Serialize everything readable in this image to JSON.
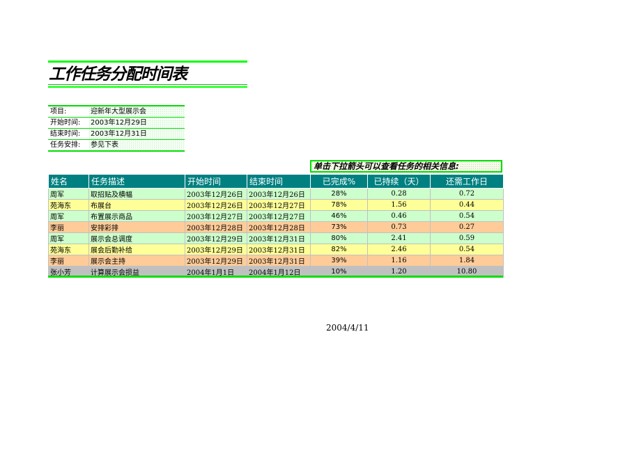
{
  "title": "工作任务分配时间表",
  "info": [
    {
      "label": "项目:",
      "value": "迎新年大型展示会"
    },
    {
      "label": "开始时间:",
      "value": "2003年12月29日"
    },
    {
      "label": "结束时间:",
      "value": "2003年12月31日"
    },
    {
      "label": "任务安排:",
      "value": "参见下表"
    }
  ],
  "hint": "单击下拉箭头可以查看任务的相关信息:",
  "table": {
    "headers": [
      "姓名",
      "任务描述",
      "开始时间",
      "结束时间",
      "已完成%",
      "已持续（天）",
      "还需工作日"
    ],
    "rows": [
      {
        "name": "周军",
        "task": "取招贴及横幅",
        "start": "2003年12月26日",
        "end": "2003年12月26日",
        "pct": "28%",
        "elapsed": "0.28",
        "remaining": "0.72",
        "color": "g"
      },
      {
        "name": "苑海东",
        "task": "布展台",
        "start": "2003年12月26日",
        "end": "2003年12月27日",
        "pct": "78%",
        "elapsed": "1.56",
        "remaining": "0.44",
        "color": "y"
      },
      {
        "name": "周军",
        "task": "布置展示商品",
        "start": "2003年12月27日",
        "end": "2003年12月27日",
        "pct": "46%",
        "elapsed": "0.46",
        "remaining": "0.54",
        "color": "g"
      },
      {
        "name": "李丽",
        "task": "安排彩排",
        "start": "2003年12月28日",
        "end": "2003年12月28日",
        "pct": "73%",
        "elapsed": "0.73",
        "remaining": "0.27",
        "color": "o"
      },
      {
        "name": "周军",
        "task": "展示会总调度",
        "start": "2003年12月29日",
        "end": "2003年12月31日",
        "pct": "80%",
        "elapsed": "2.41",
        "remaining": "0.59",
        "color": "g"
      },
      {
        "name": "苑海东",
        "task": "展会后勤补给",
        "start": "2003年12月29日",
        "end": "2003年12月31日",
        "pct": "82%",
        "elapsed": "2.46",
        "remaining": "0.54",
        "color": "y"
      },
      {
        "name": "李丽",
        "task": "展示会主持",
        "start": "2003年12月29日",
        "end": "2003年12月31日",
        "pct": "39%",
        "elapsed": "1.16",
        "remaining": "1.84",
        "color": "o"
      },
      {
        "name": "张小芳",
        "task": "计算展示会损益",
        "start": "2004年1月1日",
        "end": "2004年1月12日",
        "pct": "10%",
        "elapsed": "1.20",
        "remaining": "10.80",
        "color": "s"
      }
    ]
  },
  "footer_date": "2004/4/11",
  "colors": {
    "header": "#008080",
    "accent_green": "#00ff00",
    "row_green": "#ccffcc",
    "row_yellow": "#ffff99",
    "row_orange": "#ffcc99",
    "row_gray": "#c0c0c0"
  }
}
